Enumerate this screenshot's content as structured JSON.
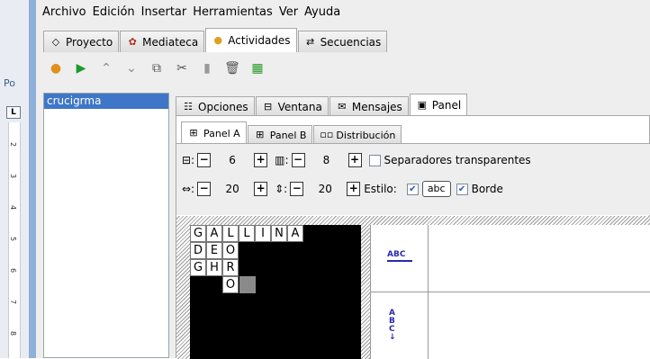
{
  "menu": [
    "Archivo",
    "Edición",
    "Insertar",
    "Herramientas",
    "Ver",
    "Ayuda"
  ],
  "main_tabs": [
    {
      "label": "Proyecto",
      "icon": "shapes-icon"
    },
    {
      "label": "Mediateca",
      "icon": "media-icon"
    },
    {
      "label": "Actividades",
      "icon": "activity-icon",
      "active": true
    },
    {
      "label": "Secuencias",
      "icon": "sequence-icon"
    }
  ],
  "left_strip": {
    "label": "Po",
    "corner": "L",
    "ruler_marks": [
      "2",
      "3",
      "4",
      "5",
      "6",
      "7",
      "8"
    ]
  },
  "activity_list": [
    "crucigrma"
  ],
  "sub_tabs": [
    {
      "label": "Opciones"
    },
    {
      "label": "Ventana"
    },
    {
      "label": "Mensajes"
    },
    {
      "label": "Panel",
      "active": true
    }
  ],
  "panel_tabs": [
    {
      "label": "Panel A",
      "active": true
    },
    {
      "label": "Panel B"
    },
    {
      "label": "Distribución"
    }
  ],
  "controls": {
    "rows_value": "6",
    "cols_value": "8",
    "transparent_separators": "Separadores transparentes",
    "width_value": "20",
    "height_value": "20",
    "style_label": "Estilo:",
    "style_value": "abc",
    "border_label": "Borde"
  },
  "crossword": [
    [
      "G",
      "A",
      "L",
      "L",
      "I",
      "N",
      "A"
    ],
    [
      "D",
      "E",
      "O"
    ],
    [
      "G",
      "H",
      "R"
    ],
    [
      "",
      "",
      "O"
    ]
  ],
  "clue_labels": {
    "across": "ABC",
    "down": [
      "A",
      "B",
      "C"
    ]
  }
}
